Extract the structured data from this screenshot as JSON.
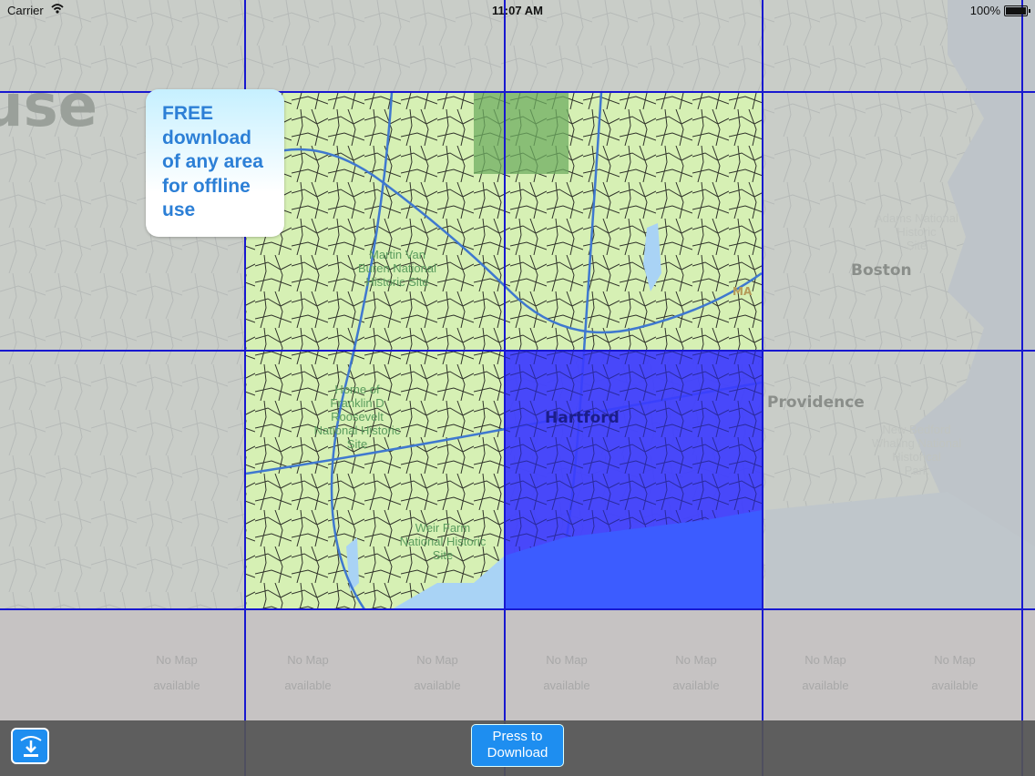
{
  "status_bar": {
    "carrier": "Carrier",
    "time": "11:07 AM",
    "battery": "100%"
  },
  "promo": {
    "text": "FREE\ndownload\nof any area\nfor offline\nuse"
  },
  "map": {
    "faded_word": "use",
    "places": {
      "martin_van_buren": "Martin Van\nBuren National\nHistoric Site",
      "franklin_roosevelt": "Home of\nFranklin D\nRoosevelt\nNational Historic\nSite",
      "weir_farm": "Weir Farm\nNational Historic\nSite",
      "boston_site": "Adams National\nHistoric\nSite",
      "new_bedford": "New Bedford\nWhaling National\nHistorical\nPark"
    },
    "cities": {
      "hartford": "Hartford",
      "boston": "Boston",
      "providence": "Providence"
    },
    "state": "MA",
    "no_map_line1": "No Map",
    "no_map_line2": "available",
    "colors": {
      "downloaded_tile": "#d6f0b4",
      "selected_tile": "#3a3aff",
      "grid_line": "#1818d0",
      "water": "#a9d3f5"
    }
  },
  "toolbar": {
    "download_icon": "download-icon",
    "press_download": "Press to\nDownload"
  }
}
